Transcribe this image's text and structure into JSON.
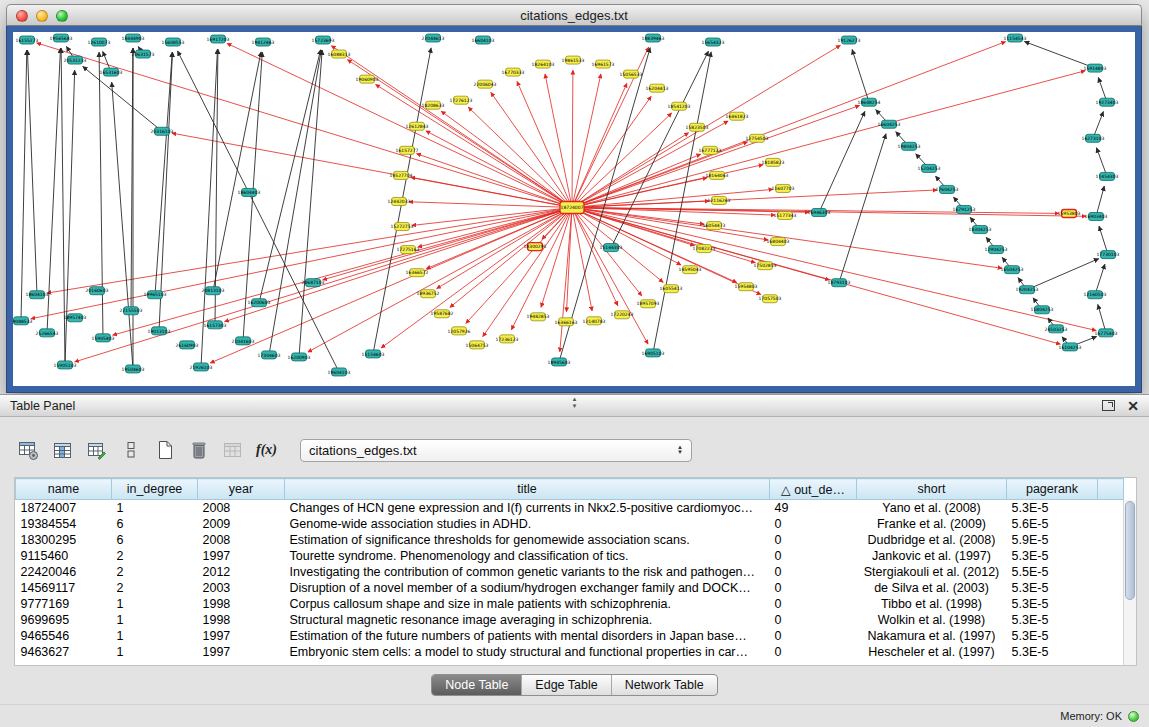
{
  "window": {
    "title": "citations_edges.txt"
  },
  "table_panel": {
    "title": "Table Panel",
    "toolbar": {
      "icons": [
        "table-settings",
        "column-chooser",
        "edit-table",
        "rows",
        "new-document",
        "delete",
        "import-table",
        "function-builder"
      ],
      "fx_label": "f(x)",
      "network_select": "citations_edges.txt"
    },
    "tabs": [
      {
        "label": "Node Table",
        "active": true
      },
      {
        "label": "Edge Table",
        "active": false
      },
      {
        "label": "Network Table",
        "active": false
      }
    ]
  },
  "table": {
    "columns": [
      {
        "label": "name"
      },
      {
        "label": "in_degree"
      },
      {
        "label": "year"
      },
      {
        "label": "title"
      },
      {
        "label": "out_de…",
        "sort": "△"
      },
      {
        "label": "short"
      },
      {
        "label": "pagerank"
      }
    ],
    "rows": [
      [
        "18724007",
        "1",
        "2008",
        "Changes of HCN gene expression and I(f) currents in Nkx2.5-positive cardiomyoc…",
        "49",
        "Yano et al. (2008)",
        "5.3E-5"
      ],
      [
        "19384554",
        "6",
        "2009",
        "Genome-wide association studies in ADHD.",
        "0",
        "Franke et al. (2009)",
        "5.6E-5"
      ],
      [
        "18300295",
        "6",
        "2008",
        "Estimation of significance thresholds for genomewide association scans.",
        "0",
        "Dudbridge et al. (2008)",
        "5.9E-5"
      ],
      [
        "9115460",
        "2",
        "1997",
        "Tourette syndrome. Phenomenology and classification of tics.",
        "0",
        "Jankovic et al. (1997)",
        "5.3E-5"
      ],
      [
        "22420046",
        "2",
        "2012",
        "Investigating the contribution of common genetic variants to the risk and pathogen…",
        "0",
        "Stergiakouli et al. (2012)",
        "5.5E-5"
      ],
      [
        "14569117",
        "2",
        "2003",
        "Disruption of a novel member of a sodium/hydrogen exchanger family and DOCK…",
        "0",
        "de Silva et al. (2003)",
        "5.3E-5"
      ],
      [
        "9777169",
        "1",
        "1998",
        "Corpus callosum shape and size in male patients with schizophrenia.",
        "0",
        "Tibbo et al. (1998)",
        "5.3E-5"
      ],
      [
        "9699695",
        "1",
        "1998",
        "Structural magnetic resonance image averaging in schizophrenia.",
        "0",
        "Wolkin et al. (1998)",
        "5.3E-5"
      ],
      [
        "9465546",
        "1",
        "1997",
        "Estimation of the future numbers of patients with mental disorders in Japan base…",
        "0",
        "Nakamura et al. (1997)",
        "5.3E-5"
      ],
      [
        "9463627",
        "1",
        "1997",
        "Embryonic stem cells: a model to study structural and functional properties in car…",
        "0",
        "Hescheler et al. (1997)",
        "5.3E-5"
      ]
    ]
  },
  "status": {
    "memory": "Memory: OK"
  },
  "graph": {
    "colors": {
      "node_yellow": "#f4ee4e",
      "node_teal": "#35b5ae",
      "edge_red": "#e1251f",
      "edge_black": "#2a2a2a",
      "hub_border": "#e0241f"
    },
    "nodes": [
      [
        559,
        175,
        "h",
        "18724007"
      ],
      [
        420,
        73,
        "y",
        "18208633"
      ],
      [
        404,
        94,
        "y",
        "12612843"
      ],
      [
        394,
        118,
        "y",
        "16157277"
      ],
      [
        388,
        143,
        "y",
        "14527704"
      ],
      [
        386,
        169,
        "y",
        "12442033"
      ],
      [
        389,
        194,
        "y",
        "15272753"
      ],
      [
        395,
        217,
        "y",
        "17275163"
      ],
      [
        404,
        240,
        "y",
        "16366572"
      ],
      [
        415,
        261,
        "y",
        "18936752"
      ],
      [
        429,
        281,
        "y",
        "19587682"
      ],
      [
        446,
        298,
        "y",
        "12057926"
      ],
      [
        464,
        312,
        "y",
        "15064753"
      ],
      [
        448,
        68,
        "y",
        "17276123"
      ],
      [
        472,
        52,
        "y",
        "22006043"
      ],
      [
        500,
        40,
        "y",
        "16770333"
      ],
      [
        530,
        32,
        "y",
        "18264103"
      ],
      [
        560,
        28,
        "y",
        "19861533"
      ],
      [
        590,
        32,
        "y",
        "16961573"
      ],
      [
        618,
        42,
        "y",
        "15056533"
      ],
      [
        644,
        56,
        "y",
        "16204413"
      ],
      [
        666,
        74,
        "y",
        "18541203"
      ],
      [
        684,
        95,
        "y",
        "15823503"
      ],
      [
        697,
        118,
        "y",
        "16777123"
      ],
      [
        704,
        143,
        "y",
        "18164063"
      ],
      [
        706,
        168,
        "y",
        "12116263"
      ],
      [
        701,
        193,
        "y",
        "16054473"
      ],
      [
        691,
        216,
        "y",
        "17082223"
      ],
      [
        677,
        237,
        "y",
        "14595043"
      ],
      [
        658,
        256,
        "y",
        "16055413"
      ],
      [
        635,
        271,
        "y",
        "18957093"
      ],
      [
        609,
        282,
        "y",
        "17220243"
      ],
      [
        581,
        288,
        "y",
        "12140783"
      ],
      [
        553,
        289,
        "y",
        "16366163"
      ],
      [
        525,
        284,
        "y",
        "19482853"
      ],
      [
        494,
        306,
        "y",
        "17236123"
      ],
      [
        724,
        84,
        "y",
        "16461823"
      ],
      [
        744,
        106,
        "y",
        "12754503"
      ],
      [
        760,
        130,
        "y",
        "18185823"
      ],
      [
        770,
        156,
        "y",
        "11607703"
      ],
      [
        772,
        183,
        "y",
        "15177343"
      ],
      [
        765,
        209,
        "y",
        "16804403"
      ],
      [
        752,
        233,
        "y",
        "17502853"
      ],
      [
        733,
        254,
        "y",
        "15954803"
      ],
      [
        326,
        22,
        "y",
        "16088313"
      ],
      [
        354,
        47,
        "y",
        "19060903"
      ],
      [
        757,
        266,
        "y",
        "17057503"
      ],
      [
        522,
        214,
        "s",
        "18300295"
      ],
      [
        14,
        8,
        "t",
        "16155273"
      ],
      [
        48,
        6,
        "t",
        "19565683"
      ],
      [
        86,
        10,
        "t",
        "12610073"
      ],
      [
        120,
        6,
        "t",
        "18444903"
      ],
      [
        160,
        10,
        "t",
        "15608553"
      ],
      [
        205,
        7,
        "t",
        "16917203"
      ],
      [
        250,
        10,
        "t",
        "19412463"
      ],
      [
        310,
        8,
        "t",
        "15723693"
      ],
      [
        420,
        6,
        "t",
        "22044613"
      ],
      [
        470,
        8,
        "t",
        "16604103"
      ],
      [
        640,
        6,
        "t",
        "18839463"
      ],
      [
        700,
        10,
        "t",
        "15654323"
      ],
      [
        836,
        8,
        "t",
        "19126273"
      ],
      [
        1002,
        6,
        "t",
        "11154543"
      ],
      [
        62,
        28,
        "t",
        "20531233"
      ],
      [
        98,
        40,
        "t",
        "16531603"
      ],
      [
        130,
        22,
        "t",
        "20631573"
      ],
      [
        8,
        288,
        "t",
        "19088533"
      ],
      [
        34,
        300,
        "t",
        "25266543"
      ],
      [
        62,
        285,
        "t",
        "18957403"
      ],
      [
        90,
        305,
        "t",
        "15905403"
      ],
      [
        118,
        278,
        "t",
        "22155503"
      ],
      [
        146,
        298,
        "t",
        "19013103"
      ],
      [
        174,
        312,
        "t",
        "26160903"
      ],
      [
        202,
        292,
        "t",
        "16157303"
      ],
      [
        230,
        308,
        "t",
        "21041603"
      ],
      [
        24,
        262,
        "t",
        "18604103"
      ],
      [
        84,
        258,
        "t",
        "20160603"
      ],
      [
        142,
        262,
        "t",
        "19965103"
      ],
      [
        200,
        258,
        "t",
        "20813103"
      ],
      [
        246,
        270,
        "t",
        "16200603"
      ],
      [
        52,
        332,
        "t",
        "15905103"
      ],
      [
        120,
        336,
        "t",
        "19504603"
      ],
      [
        188,
        334,
        "t",
        "21926103"
      ],
      [
        256,
        322,
        "t",
        "17304603"
      ],
      [
        149,
        99,
        "t",
        "20316103"
      ],
      [
        236,
        160,
        "t",
        "18604403"
      ],
      [
        300,
        250,
        "t",
        "20687103"
      ],
      [
        286,
        324,
        "t",
        "16200903"
      ],
      [
        326,
        339,
        "t",
        "19604103"
      ],
      [
        360,
        321,
        "t",
        "15154603"
      ],
      [
        598,
        215,
        "t",
        "15144303"
      ],
      [
        546,
        329,
        "t",
        "18945603"
      ],
      [
        640,
        320,
        "t",
        "16905103"
      ],
      [
        856,
        70,
        "t",
        "18648254"
      ],
      [
        876,
        92,
        "t",
        "16604253"
      ],
      [
        896,
        114,
        "t",
        "19804253"
      ],
      [
        916,
        136,
        "t",
        "15204253"
      ],
      [
        934,
        157,
        "t",
        "17604253"
      ],
      [
        951,
        177,
        "t",
        "16791253"
      ],
      [
        967,
        197,
        "t",
        "18304253"
      ],
      [
        983,
        217,
        "t",
        "12904253"
      ],
      [
        999,
        237,
        "t",
        "16504253"
      ],
      [
        1014,
        257,
        "t",
        "19204253"
      ],
      [
        1029,
        277,
        "t",
        "15804253"
      ],
      [
        1043,
        296,
        "t",
        "24503253"
      ],
      [
        1057,
        314,
        "t",
        "16104253"
      ],
      [
        1082,
        36,
        "t",
        "15914803"
      ],
      [
        1094,
        70,
        "t",
        "19273403"
      ],
      [
        1080,
        106,
        "t",
        "16273103"
      ],
      [
        1094,
        144,
        "t",
        "11454303"
      ],
      [
        1083,
        184,
        "t",
        "16903403"
      ],
      [
        1095,
        222,
        "t",
        "17730103"
      ],
      [
        1082,
        262,
        "t",
        "12160503"
      ],
      [
        1093,
        300,
        "t",
        "16775403"
      ],
      [
        1056,
        181,
        "s",
        "15953803"
      ],
      [
        806,
        180,
        "t",
        "16946303"
      ],
      [
        826,
        250,
        "t",
        "18793103"
      ]
    ],
    "red_from_hub": [
      1,
      2,
      3,
      4,
      5,
      6,
      7,
      8,
      9,
      10,
      11,
      12,
      13,
      14,
      15,
      16,
      17,
      18,
      19,
      20,
      21,
      22,
      23,
      24,
      25,
      26,
      27,
      28,
      29,
      30,
      31,
      32,
      33,
      34,
      35,
      36,
      37,
      38,
      39,
      40,
      41,
      42,
      43,
      44,
      45,
      46,
      47,
      48,
      53,
      55,
      58,
      60,
      61,
      65,
      68,
      72,
      74,
      79,
      81,
      83,
      85,
      86,
      88,
      90,
      91,
      92,
      96,
      100,
      104,
      105,
      109,
      112,
      113,
      114,
      115
    ],
    "black_edges": [
      [
        65,
        48
      ],
      [
        66,
        49
      ],
      [
        68,
        50
      ],
      [
        69,
        51
      ],
      [
        70,
        52
      ],
      [
        72,
        53
      ],
      [
        73,
        54
      ],
      [
        74,
        48
      ],
      [
        76,
        52
      ],
      [
        77,
        54
      ],
      [
        78,
        55
      ],
      [
        79,
        49
      ],
      [
        80,
        51
      ],
      [
        81,
        53
      ],
      [
        82,
        55
      ],
      [
        83,
        62
      ],
      [
        62,
        49
      ],
      [
        63,
        50
      ],
      [
        64,
        51
      ],
      [
        86,
        55
      ],
      [
        87,
        52
      ],
      [
        88,
        56
      ],
      [
        79,
        62
      ],
      [
        80,
        63
      ],
      [
        93,
        92
      ],
      [
        94,
        93
      ],
      [
        95,
        94
      ],
      [
        96,
        95
      ],
      [
        97,
        96
      ],
      [
        98,
        97
      ],
      [
        99,
        98
      ],
      [
        100,
        99
      ],
      [
        101,
        100
      ],
      [
        102,
        101
      ],
      [
        103,
        102
      ],
      [
        104,
        103
      ],
      [
        92,
        60
      ],
      [
        105,
        61
      ],
      [
        106,
        105
      ],
      [
        107,
        106
      ],
      [
        108,
        107
      ],
      [
        109,
        108
      ],
      [
        110,
        109
      ],
      [
        111,
        110
      ],
      [
        112,
        111
      ],
      [
        104,
        112
      ],
      [
        101,
        110
      ],
      [
        90,
        58
      ],
      [
        91,
        59
      ],
      [
        89,
        59
      ],
      [
        114,
        92
      ],
      [
        115,
        93
      ]
    ]
  }
}
